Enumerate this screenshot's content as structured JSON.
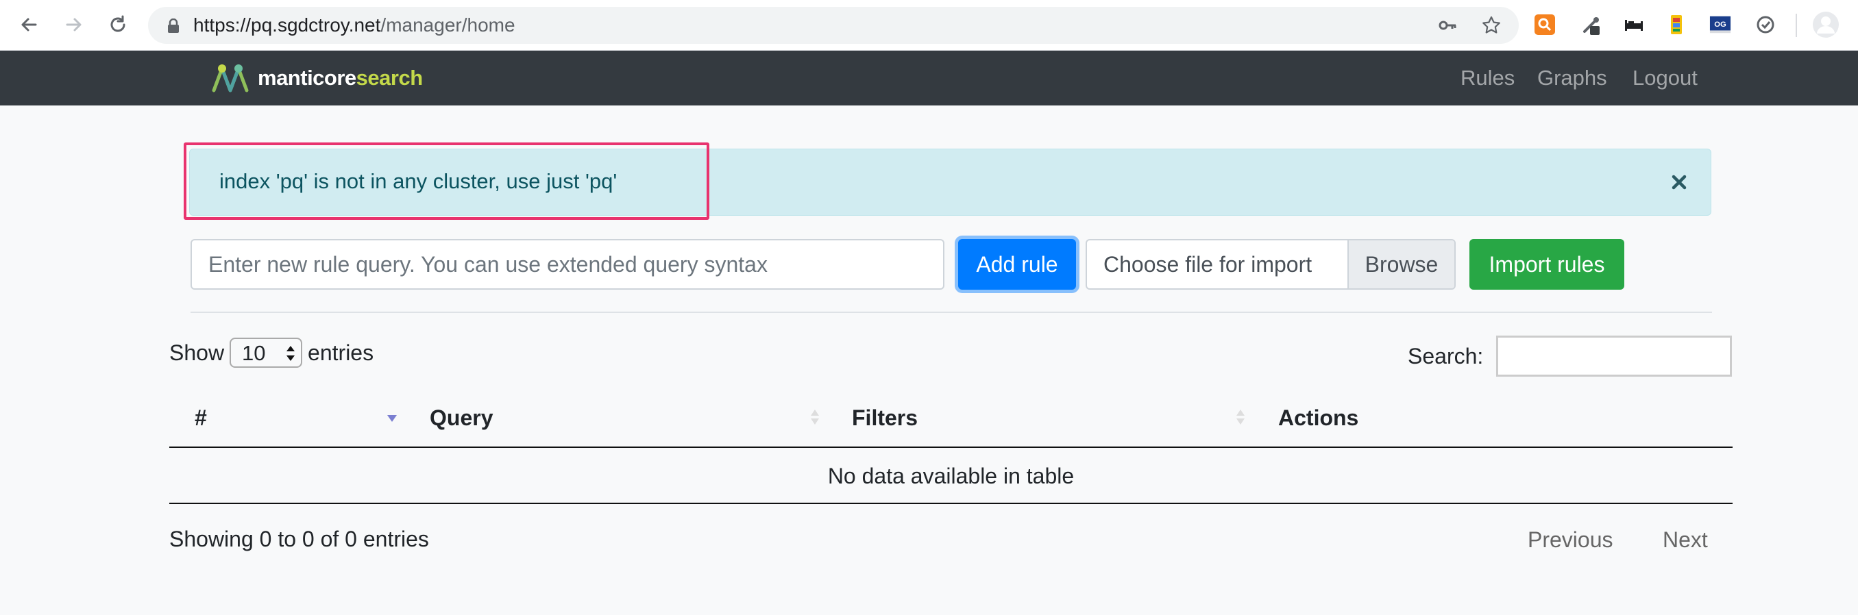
{
  "browser": {
    "url_host": "https://pq.sgdctroy.net",
    "url_path": "/manager/home",
    "icons": [
      "back-icon",
      "forward-icon",
      "reload-icon",
      "lock-icon",
      "key-icon",
      "star-icon"
    ],
    "extensions": [
      "orange-search-extension-icon",
      "eyedropper-extension-icon",
      "bed-extension-icon",
      "book-extension-icon",
      "og-extension-icon",
      "check-extension-icon",
      "profile-avatar-icon"
    ],
    "extension_og_text": "OG"
  },
  "navbar": {
    "brand_primary": "manticore",
    "brand_secondary": "search",
    "links": [
      "Rules",
      "Graphs",
      "Logout"
    ],
    "colors": {
      "background": "#343a40",
      "brand_accent": "#c4d94a"
    }
  },
  "alert": {
    "message": "index 'pq' is not in any cluster, use just 'pq'",
    "close_symbol": "×",
    "highlight_color": "#e8336e"
  },
  "form": {
    "rule_placeholder": "Enter new rule query. You can use extended query syntax",
    "add_label": "Add rule",
    "file_label": "Choose file for import",
    "browse_label": "Browse",
    "import_label": "Import rules",
    "colors": {
      "add": "#007bff",
      "import": "#28a745"
    }
  },
  "table": {
    "length": {
      "show_label": "Show",
      "value": "10",
      "entries_label": "entries"
    },
    "search_label": "Search:",
    "columns": [
      "#",
      "Query",
      "Filters",
      "Actions"
    ],
    "sorted_column": "#",
    "empty_message": "No data available in table",
    "info": "Showing 0 to 0 of 0 entries",
    "pagination": {
      "previous": "Previous",
      "next": "Next"
    }
  }
}
